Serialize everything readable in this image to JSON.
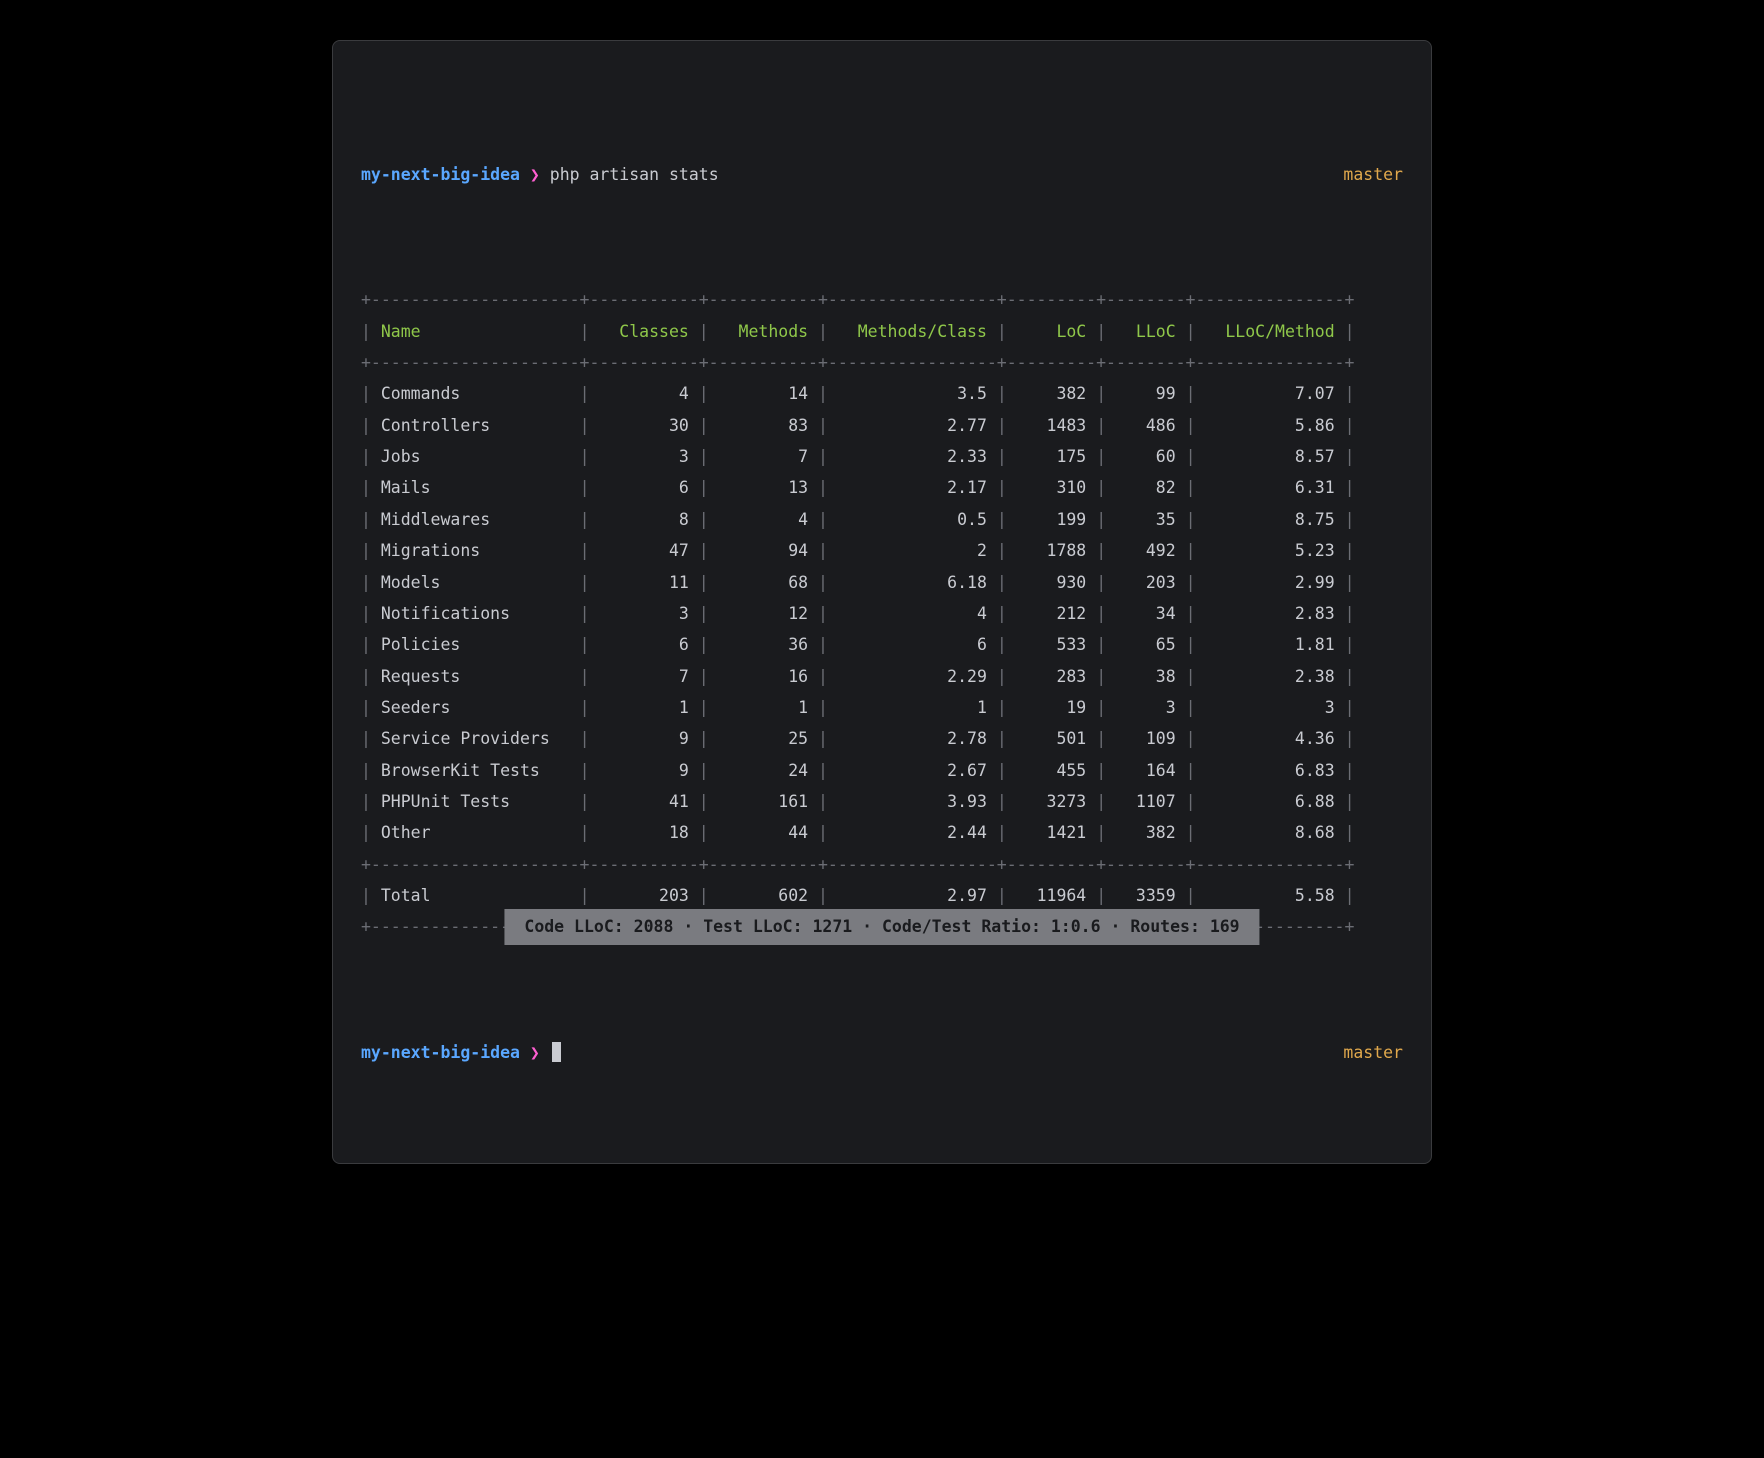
{
  "prompt": {
    "directory": "my-next-big-idea",
    "separator": "❯",
    "command": "php artisan stats",
    "branch": "master"
  },
  "table": {
    "columns": [
      "Name",
      "Classes",
      "Methods",
      "Methods/Class",
      "LoC",
      "LLoC",
      "LLoC/Method"
    ],
    "widths": [
      19,
      9,
      9,
      15,
      7,
      6,
      13
    ],
    "align": [
      "left",
      "right",
      "right",
      "right",
      "right",
      "right",
      "right"
    ],
    "rows": [
      [
        "Commands",
        "4",
        "14",
        "3.5",
        "382",
        "99",
        "7.07"
      ],
      [
        "Controllers",
        "30",
        "83",
        "2.77",
        "1483",
        "486",
        "5.86"
      ],
      [
        "Jobs",
        "3",
        "7",
        "2.33",
        "175",
        "60",
        "8.57"
      ],
      [
        "Mails",
        "6",
        "13",
        "2.17",
        "310",
        "82",
        "6.31"
      ],
      [
        "Middlewares",
        "8",
        "4",
        "0.5",
        "199",
        "35",
        "8.75"
      ],
      [
        "Migrations",
        "47",
        "94",
        "2",
        "1788",
        "492",
        "5.23"
      ],
      [
        "Models",
        "11",
        "68",
        "6.18",
        "930",
        "203",
        "2.99"
      ],
      [
        "Notifications",
        "3",
        "12",
        "4",
        "212",
        "34",
        "2.83"
      ],
      [
        "Policies",
        "6",
        "36",
        "6",
        "533",
        "65",
        "1.81"
      ],
      [
        "Requests",
        "7",
        "16",
        "2.29",
        "283",
        "38",
        "2.38"
      ],
      [
        "Seeders",
        "1",
        "1",
        "1",
        "19",
        "3",
        "3"
      ],
      [
        "Service Providers",
        "9",
        "25",
        "2.78",
        "501",
        "109",
        "4.36"
      ],
      [
        "BrowserKit Tests",
        "9",
        "24",
        "2.67",
        "455",
        "164",
        "6.83"
      ],
      [
        "PHPUnit Tests",
        "41",
        "161",
        "3.93",
        "3273",
        "1107",
        "6.88"
      ],
      [
        "Other",
        "18",
        "44",
        "2.44",
        "1421",
        "382",
        "8.68"
      ]
    ],
    "total": [
      "Total",
      "203",
      "602",
      "2.97",
      "11964",
      "3359",
      "5.58"
    ]
  },
  "summary": {
    "text": " Code LLoC: 2088 · Test LLoC: 1271 · Code/Test Ratio: 1:0.6 · Routes: 169 "
  },
  "prompt2": {
    "directory": "my-next-big-idea",
    "separator": "❯",
    "branch": "master"
  }
}
